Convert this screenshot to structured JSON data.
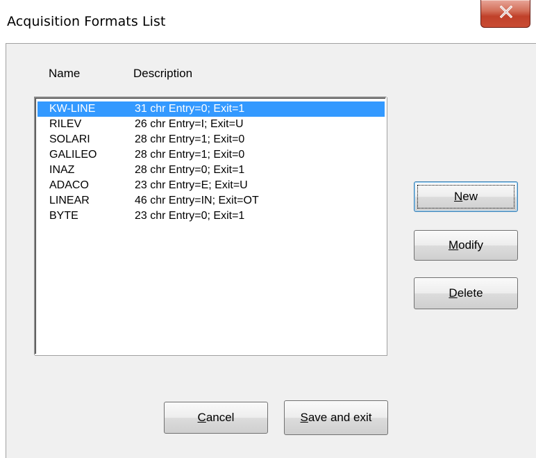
{
  "window": {
    "title": "Acquisition Formats List"
  },
  "columns": {
    "name": "Name",
    "description": "Description"
  },
  "formats": [
    {
      "name": "KW-LINE",
      "description": "31 chr Entry=0; Exit=1",
      "selected": true
    },
    {
      "name": "RILEV",
      "description": "26 chr Entry=I; Exit=U",
      "selected": false
    },
    {
      "name": "SOLARI",
      "description": "28 chr Entry=1; Exit=0",
      "selected": false
    },
    {
      "name": "GALILEO",
      "description": "28 chr Entry=1; Exit=0",
      "selected": false
    },
    {
      "name": "INAZ",
      "description": "28 chr Entry=0; Exit=1",
      "selected": false
    },
    {
      "name": "ADACO",
      "description": "23 chr Entry=E; Exit=U",
      "selected": false
    },
    {
      "name": "LINEAR",
      "description": "46 chr Entry=IN; Exit=OT",
      "selected": false
    },
    {
      "name": "BYTE",
      "description": "23 chr Entry=0; Exit=1",
      "selected": false
    }
  ],
  "buttons": {
    "new": "New",
    "modify": "Modify",
    "delete": "Delete",
    "cancel": "Cancel",
    "save_exit": "Save and exit"
  },
  "colors": {
    "selection": "#3399ff",
    "dialog_background": "#f0f0f0",
    "close_button": "#c0412a"
  },
  "icons": {
    "close": "close-icon"
  }
}
